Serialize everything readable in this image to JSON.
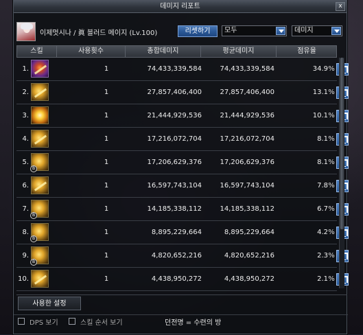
{
  "window": {
    "title": "데미지 리포트",
    "close_label": "x"
  },
  "header": {
    "character_text": "이제멋시나 / 眞 블러드 메이지 (Lv.100)",
    "reset_button": "리셋하기",
    "filter_select": "모두",
    "mode_select": "데미지"
  },
  "table": {
    "columns": [
      "스킬",
      "사용횟수",
      "총합데미지",
      "평균데미지",
      "점유율"
    ],
    "percent_sign": "%",
    "rows": [
      {
        "rank": "1.",
        "uses": "1",
        "total": "74,433,339,584",
        "avg": "74,433,339,584",
        "share": "34.9",
        "icon": "purple-burst-skill-icon"
      },
      {
        "rank": "2.",
        "uses": "1",
        "total": "27,857,406,400",
        "avg": "27,857,406,400",
        "share": "13.1",
        "icon": "golden-claw-skill-icon"
      },
      {
        "rank": "3.",
        "uses": "1",
        "total": "21,444,929,536",
        "avg": "21,444,929,536",
        "share": "10.1",
        "icon": "golden-explosion-skill-icon"
      },
      {
        "rank": "4.",
        "uses": "1",
        "total": "17,216,072,704",
        "avg": "17,216,072,704",
        "share": "8.1",
        "icon": "golden-slash-skill-icon"
      },
      {
        "rank": "5.",
        "uses": "1",
        "total": "17,206,629,376",
        "avg": "17,206,629,376",
        "share": "8.1",
        "icon": "golden-beast-skill-icon"
      },
      {
        "rank": "6.",
        "uses": "1",
        "total": "16,597,743,104",
        "avg": "16,597,743,104",
        "share": "7.8",
        "icon": "golden-wave-skill-icon"
      },
      {
        "rank": "7.",
        "uses": "1",
        "total": "14,185,338,112",
        "avg": "14,185,338,112",
        "share": "6.7",
        "icon": "golden-spiral-skill-icon"
      },
      {
        "rank": "8.",
        "uses": "1",
        "total": "8,895,229,664",
        "avg": "8,895,229,664",
        "share": "4.2",
        "icon": "golden-wing-skill-icon"
      },
      {
        "rank": "9.",
        "uses": "1",
        "total": "4,820,652,216",
        "avg": "4,820,652,216",
        "share": "2.3",
        "icon": "golden-orb-skill-icon"
      },
      {
        "rank": "10.",
        "uses": "1",
        "total": "4,438,950,272",
        "avg": "4,438,950,272",
        "share": "2.1",
        "icon": "golden-fang-skill-icon"
      }
    ]
  },
  "tabs": {
    "used_settings": "사용한 설정"
  },
  "footer": {
    "dps_label": "DPS 보기",
    "skill_order_label": "스킬 순서 보기",
    "dungeon_text": "던전명 = 수련의 방"
  }
}
